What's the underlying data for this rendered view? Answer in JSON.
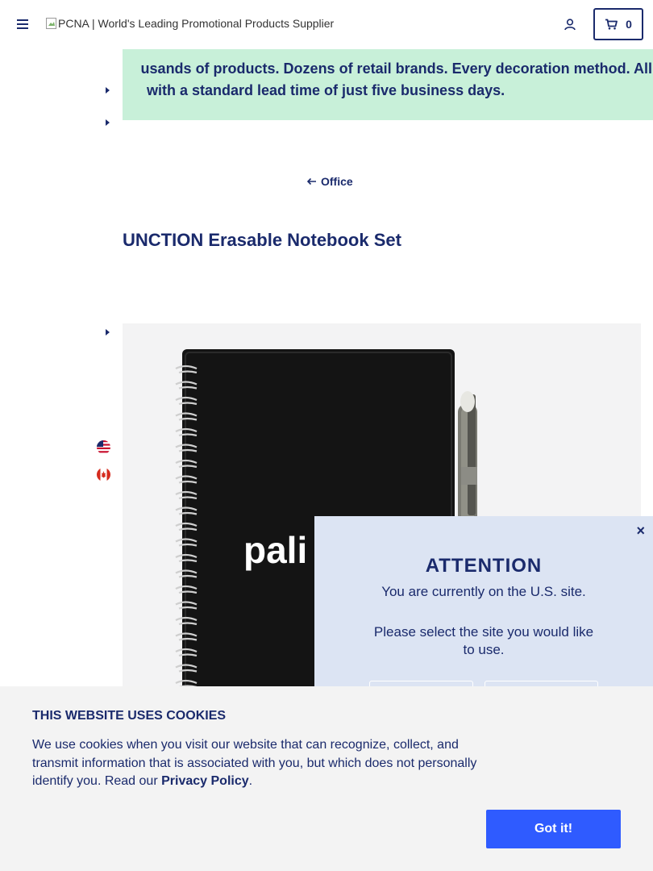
{
  "header": {
    "logo_alt": "PCNA | World's Leading Promotional Products Supplier",
    "cart_count": "0",
    "icons": {
      "menu": "hamburger-menu-icon",
      "account": "user-icon",
      "cart": "cart-icon"
    }
  },
  "banner": {
    "line1": "usands of products. Dozens of retail brands. Every decoration method. All",
    "line2": "with a standard lead time of just five business days.",
    "background": "#c8f0d9"
  },
  "breadcrumb": {
    "back_label": "Office"
  },
  "product": {
    "title": "UNCTION Erasable Notebook Set",
    "image_brand_text": "pali"
  },
  "region_popup": {
    "close_label": "×",
    "title": "ATTENTION",
    "message": "You are currently on the U.S. site.",
    "question": "Please select the site you would like to use."
  },
  "cookie_banner": {
    "title": "THIS WEBSITE USES COOKIES",
    "text": "We use cookies when you visit our website that can recognize, collect, and transmit information that is associated with you, but which does not personally identify you. Read our",
    "policy_link": "Privacy Policy",
    "period": ".",
    "button_label": "Got it!"
  },
  "colors": {
    "primary": "#1a2a6c",
    "accent": "#2f5bff",
    "popup_bg": "#dce4f3"
  }
}
